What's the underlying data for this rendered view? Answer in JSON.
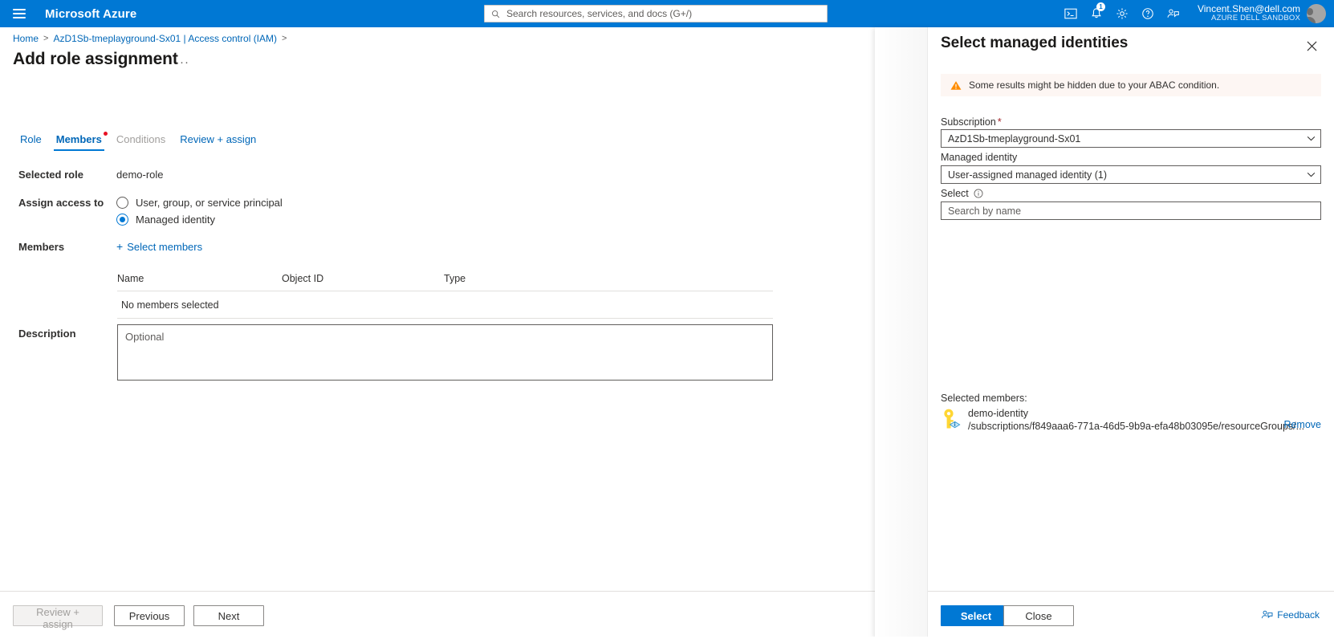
{
  "topbar": {
    "menu_icon": "hamburger-icon",
    "brand": "Microsoft Azure",
    "search_placeholder": "Search resources, services, and docs (G+/)",
    "search_value": "",
    "icons": [
      {
        "name": "cloud-shell-icon",
        "label": "Cloud Shell"
      },
      {
        "name": "notifications-icon",
        "label": "Notifications",
        "badge": "1"
      },
      {
        "name": "gear-icon",
        "label": "Settings"
      },
      {
        "name": "help-icon",
        "label": "Help"
      },
      {
        "name": "feedback-icon",
        "label": "Feedback"
      }
    ],
    "account_email": "Vincent.Shen@dell.com",
    "account_tenant": "AZURE DELL SANDBOX"
  },
  "breadcrumb": {
    "items": [
      "Home",
      "AzD1Sb-tmeplayground-Sx01 | Access control (IAM)"
    ],
    "separator": ">"
  },
  "page": {
    "title": "Add role assignment",
    "more_label": "···"
  },
  "tabs": [
    {
      "label": "Role",
      "state": "enabled"
    },
    {
      "label": "Members",
      "state": "active",
      "required_dot": true
    },
    {
      "label": "Conditions",
      "state": "disabled"
    },
    {
      "label": "Review + assign",
      "state": "enabled"
    }
  ],
  "form": {
    "selected_role_label": "Selected role",
    "selected_role_value": "demo-role",
    "assign_access_label": "Assign access to",
    "assign_options": [
      {
        "label": "User, group, or service principal",
        "checked": false
      },
      {
        "label": "Managed identity",
        "checked": true
      }
    ],
    "members_label": "Members",
    "select_members_link": "Select members",
    "select_members_plus": "+",
    "table": {
      "columns": [
        "Name",
        "Object ID",
        "Type"
      ],
      "empty_text": "No members selected",
      "rows": []
    },
    "description_label": "Description",
    "description_placeholder": "Optional",
    "description_value": ""
  },
  "blade_footer": {
    "review_assign": "Review + assign",
    "previous": "Previous",
    "next": "Next"
  },
  "panel": {
    "title": "Select managed identities",
    "close_icon": "close-icon",
    "warning": {
      "icon": "warning-icon",
      "text": "Some results might be hidden due to your ABAC condition."
    },
    "subscription_label": "Subscription",
    "subscription_required": "*",
    "subscription_value": "AzD1Sb-tmeplayground-Sx01",
    "managed_identity_label": "Managed identity",
    "managed_identity_value": "User-assigned managed identity (1)",
    "select_label": "Select",
    "select_info_icon": "info-icon",
    "search_placeholder": "Search by name",
    "search_value": "",
    "selected_members_title": "Selected members:",
    "selected_members": [
      {
        "icon": "key-identity-icon",
        "name": "demo-identity",
        "path": "/subscriptions/f849aaa6-771a-46d5-9b9a-efa48b03095e/resourceGroups/...",
        "remove_label": "Remove"
      }
    ],
    "footer": {
      "select_button": "Select",
      "close_button": "Close",
      "feedback_label": "Feedback",
      "feedback_icon": "feedback-icon"
    }
  },
  "colors": {
    "azure_blue": "#0078d4",
    "link_blue": "#0067b8",
    "required_red": "#e81123",
    "warning_orange": "#ff8c00",
    "warning_bg": "#fdf6f3",
    "key_yellow": "#ffd633"
  }
}
